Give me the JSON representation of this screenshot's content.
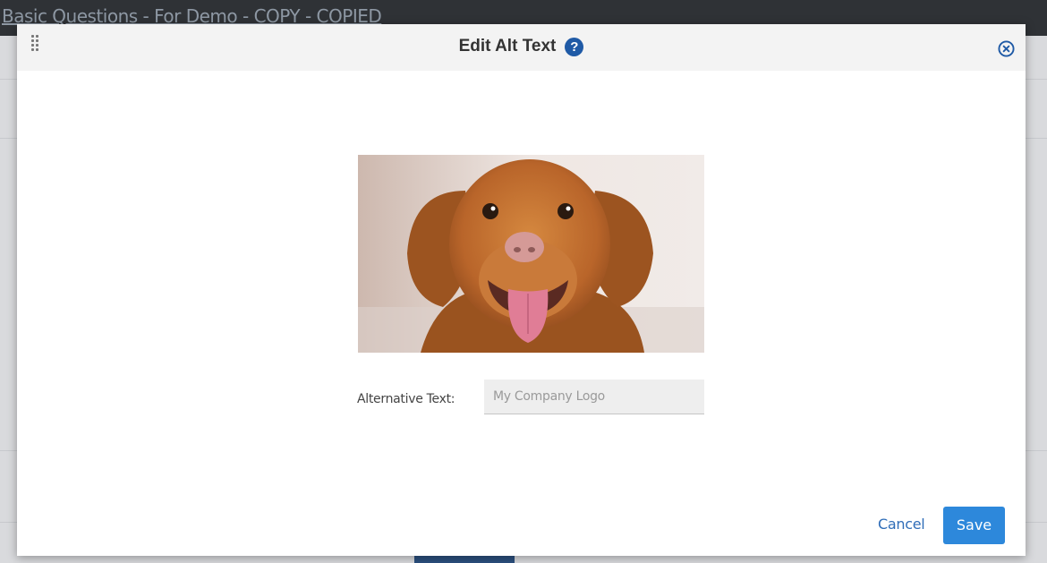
{
  "background": {
    "window_title": "Basic Questions - For Demo - COPY - COPIED"
  },
  "dialog": {
    "title": "Edit Alt Text",
    "help_glyph": "?",
    "icons": {
      "drag": "drag-handle-icon",
      "help": "help-icon",
      "close": "close-icon"
    },
    "image": "dog-photo",
    "alt_text_label": "Alternative Text:",
    "alt_text_placeholder": "My Company Logo",
    "alt_text_value": "",
    "cancel_label": "Cancel",
    "save_label": "Save"
  },
  "colors": {
    "accent": "#2d88db",
    "help_icon": "#1f5aa6",
    "link": "#2f6db8"
  }
}
